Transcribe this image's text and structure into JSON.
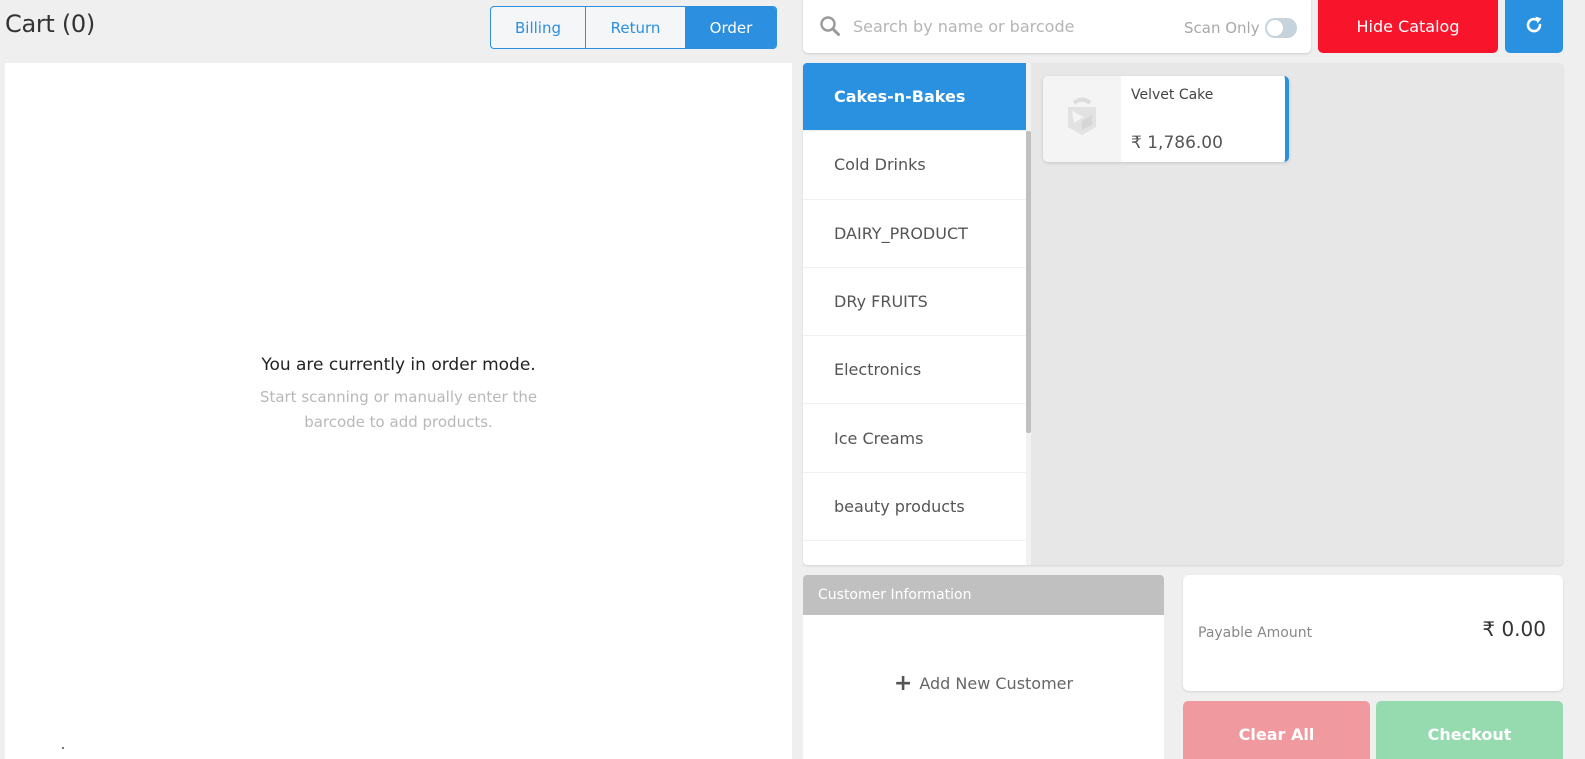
{
  "cart": {
    "title": "Cart (0)",
    "modes": [
      {
        "label": "Billing",
        "active": false
      },
      {
        "label": "Return",
        "active": false
      },
      {
        "label": "Order",
        "active": true
      }
    ],
    "empty_title": "You are currently in order mode.",
    "empty_subtitle": "Start scanning or manually enter the barcode to add products."
  },
  "search": {
    "placeholder": "Search by name or barcode",
    "value": "",
    "icon": "search-icon",
    "scan_only_label": "Scan Only",
    "scan_only_enabled": false
  },
  "toolbar": {
    "hide_catalog_label": "Hide Catalog",
    "refresh_icon": "refresh-icon"
  },
  "catalog": {
    "categories": [
      {
        "label": "Cakes-n-Bakes",
        "active": true
      },
      {
        "label": "Cold Drinks",
        "active": false
      },
      {
        "label": "DAIRY_PRODUCT",
        "active": false
      },
      {
        "label": "DRy FRUITS",
        "active": false
      },
      {
        "label": "Electronics",
        "active": false
      },
      {
        "label": "Ice Creams",
        "active": false
      },
      {
        "label": "beauty products",
        "active": false
      }
    ],
    "products": [
      {
        "name": "Velvet Cake",
        "price": "₹ 1,786.00",
        "image_icon": "product-placeholder-icon"
      }
    ]
  },
  "customer": {
    "header": "Customer Information",
    "add_label": "Add New Customer"
  },
  "payment": {
    "payable_label": "Payable Amount",
    "payable_value": "₹ 0.00",
    "clear_label": "Clear All",
    "checkout_label": "Checkout"
  },
  "colors": {
    "primary": "#2a90e0",
    "danger": "#f8142a",
    "clear_disabled": "#f09aa0",
    "checkout_disabled": "#96dab0"
  }
}
